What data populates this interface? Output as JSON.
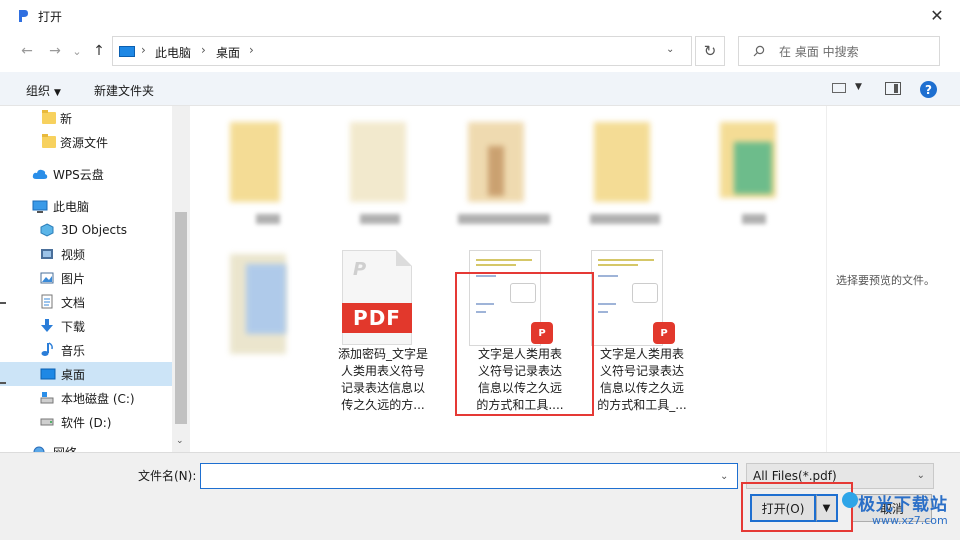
{
  "window": {
    "title": "打开"
  },
  "nav": {
    "back": "←",
    "forward": "→",
    "recent": "⌄",
    "up": "↑",
    "breadcrumbs": [
      "此电脑",
      "桌面"
    ],
    "separator": "›",
    "refresh": "↻",
    "search_placeholder": "在 桌面 中搜索"
  },
  "toolbar": {
    "organize": "组织",
    "new_folder": "新建文件夹"
  },
  "sidebar": {
    "items": [
      {
        "label": "新",
        "icon": "folder-icon"
      },
      {
        "label": "资源文件",
        "icon": "folder-icon"
      },
      {
        "label": "WPS云盘",
        "icon": "cloud-icon"
      },
      {
        "label": "此电脑",
        "icon": "computer-icon"
      },
      {
        "label": "3D Objects",
        "icon": "3d-objects-icon"
      },
      {
        "label": "视频",
        "icon": "video-icon"
      },
      {
        "label": "图片",
        "icon": "picture-icon"
      },
      {
        "label": "文档",
        "icon": "document-icon"
      },
      {
        "label": "下载",
        "icon": "download-icon"
      },
      {
        "label": "音乐",
        "icon": "music-icon"
      },
      {
        "label": "桌面",
        "icon": "desktop-icon"
      },
      {
        "label": "本地磁盘 (C:)",
        "icon": "drive-icon"
      },
      {
        "label": "软件 (D:)",
        "icon": "drive-icon"
      },
      {
        "label": "网络",
        "icon": "network-icon"
      }
    ]
  },
  "files": [
    {
      "name": "添加密码_文字是\n人类用表义符号\n记录表达信息以\n传之久远的方...",
      "type": "pdf"
    },
    {
      "name": "文字是人类用表\n义符号记录表达\n信息以传之久远\n的方式和工具....",
      "type": "pdf-preview",
      "selected": true
    },
    {
      "name": "文字是人类用表\n义符号记录表达\n信息以传之久远\n的方式和工具_...",
      "type": "pdf-preview"
    }
  ],
  "pdf_label": "PDF",
  "preview": {
    "empty_text": "选择要预览的文件。"
  },
  "bottom": {
    "filename_label": "文件名(N):",
    "filename_value": "",
    "filter_value": "All Files(*.pdf)",
    "open_label": "打开(O)",
    "cancel_label": "取消"
  },
  "watermark": {
    "text": "极光下载站",
    "url": "www.xz7.com"
  },
  "colors": {
    "accent": "#1e6fd0",
    "highlight": "#e53935",
    "pdf_red": "#e2382c",
    "selected_bg": "#cce4f7"
  }
}
